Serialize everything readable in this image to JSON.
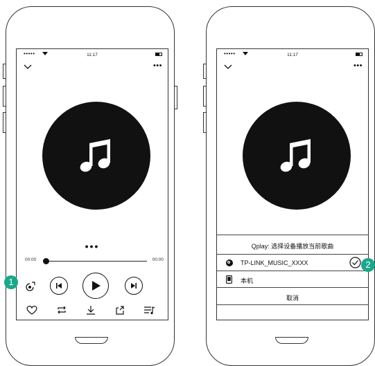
{
  "left_phone": {
    "status": {
      "signal": "•••••",
      "time": "11:17"
    },
    "progress": {
      "current": "00:00",
      "total": "00:00",
      "fraction": 0
    },
    "pager": "•••"
  },
  "right_phone": {
    "status": {
      "signal": "•••••",
      "time": "11:17"
    },
    "sheet": {
      "title": "Qplay: 选择设备播放当前歌曲",
      "device_name": "TP-LINK_MUSIC_XXXX",
      "local_label": "本机",
      "cancel_label": "取消"
    }
  },
  "markers": {
    "first": "1",
    "second": "2"
  },
  "colors": {
    "marker": "#1aa88a",
    "disc": "#111111"
  }
}
